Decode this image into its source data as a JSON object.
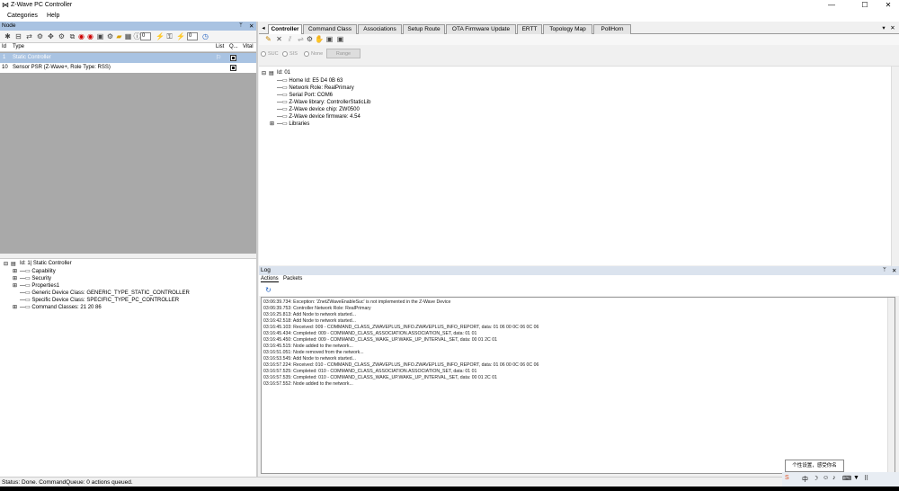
{
  "window": {
    "title": "Z-Wave PC Controller",
    "min_glyph": "—",
    "max_glyph": "☐",
    "close_glyph": "✕"
  },
  "menu": {
    "items": [
      "Categories",
      "Help"
    ]
  },
  "node_panel": {
    "title": "Node",
    "pin_glyph": "ᛘ",
    "close_glyph": "✕",
    "toolbar_values": [
      "0",
      "0"
    ],
    "columns": [
      "Id",
      "Type",
      "List",
      "Q...",
      "Vital"
    ],
    "rows": [
      {
        "id": "1",
        "type": "Static Controller",
        "selected": true
      },
      {
        "id": "10",
        "type": "Sensor PSR (Z-Wave+, Role Type: RSS)",
        "selected": false
      }
    ]
  },
  "left_tree": {
    "root": "Id: 1| Static Controller",
    "items": [
      "Capability",
      "Security",
      "Properties1",
      "Generic Device Class: GENERIC_TYPE_STATIC_CONTROLLER",
      "Specific Device Class: SPECIFIC_TYPE_PC_CONTROLLER",
      "Command Classes: 21 20 86"
    ]
  },
  "tabs": [
    "Controller",
    "Command Class",
    "Associations",
    "Setup Route",
    "OTA Firmware Update",
    "ERTT",
    "Topology Map",
    "PollHorn"
  ],
  "conn_options": {
    "labels": [
      "SUC",
      "SIS",
      "None"
    ],
    "range_button": "Range"
  },
  "controller_tree": {
    "root": "Id: 01",
    "items": [
      "Home Id: E5 D4 0B 63",
      "Network Role: RealPrimary",
      "Serial Port: COM6",
      "Z-Wave library: ControllerStaticLib",
      "Z-Wave device chip: ZW0500",
      "Z-Wave device firmware: 4.54",
      "Libraries"
    ]
  },
  "log": {
    "title": "Log",
    "subtabs": [
      "Actions",
      "Packets"
    ],
    "lines": [
      "03:06:39.734: Exception: 'ZnetZWaveEnableSuc' is not implemented in the Z-Wave Device",
      "03:06:39.753: Controller Network Role: RealPrimary",
      "03:16:25.813: Add Node to network started...",
      "03:16:42.518: Add Node to network started...",
      "03:16:45.103: Received: 009 - COMMAND_CLASS_ZWAVEPLUS_INFO.ZWAVEPLUS_INFO_REPORT, data: 01 06 00 0C 06 0C 06",
      "03:16:45.434: Completed: 009 - COMMAND_CLASS_ASSOCIATION.ASSOCIATION_SET, data: 01 01",
      "03:16:45.450: Completed: 009 - COMMAND_CLASS_WAKE_UP.WAKE_UP_INTERVAL_SET, data: 00 01 2C 01",
      "03:16:45.515: Node added to the network...",
      "03:16:51.051: Node removed from the network...",
      "03:16:53.545: Add Node to network started...",
      "03:16:57.224: Received: 010 - COMMAND_CLASS_ZWAVEPLUS_INFO.ZWAVEPLUS_INFO_REPORT, data: 01 06 00 0C 06 0C 06",
      "03:16:57.525: Completed: 010 - COMMAND_CLASS_ASSOCIATION.ASSOCIATION_SET, data: 01 01",
      "03:16:57.535: Completed: 010 - COMMAND_CLASS_WAKE_UP.WAKE_UP_INTERVAL_SET, data: 00 01 2C 01",
      "03:16:57.552: Node added to the network..."
    ]
  },
  "status": "Status: Done. CommandQueue: 0 actions queued.",
  "tray": {
    "tooltip": "个性设置，感受你名",
    "ime": "中"
  }
}
